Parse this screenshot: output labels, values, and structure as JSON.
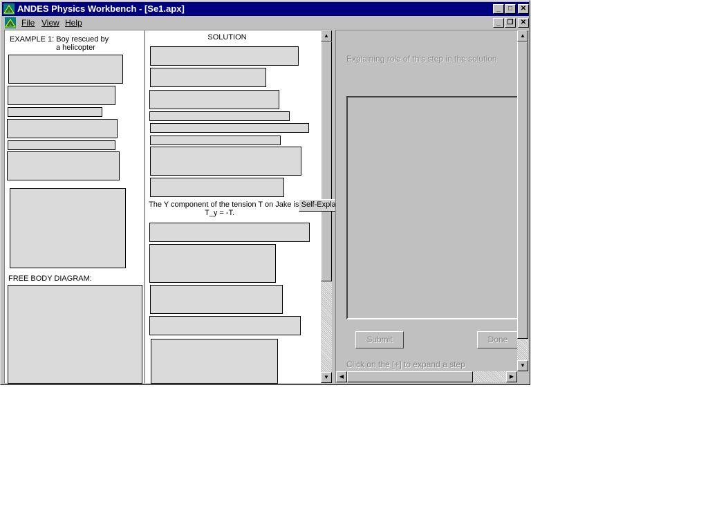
{
  "window": {
    "title": "ANDES Physics Workbench - [Se1.apx]",
    "controls": {
      "minimize": "_",
      "maximize": "□",
      "close": "✕"
    }
  },
  "menubar": {
    "items": [
      {
        "label": "File"
      },
      {
        "label": "View"
      },
      {
        "label": "Help"
      }
    ],
    "controls": {
      "minimize": "_",
      "restore": "❐",
      "close": "✕"
    }
  },
  "example_pane": {
    "title_line1": "EXAMPLE 1: Boy rescued by",
    "title_line2": "a helicopter",
    "fbd_label": "FREE BODY DIAGRAM:"
  },
  "solution_pane": {
    "header": "SOLUTION",
    "step_text_line1": "The Y component of the tension T on Jake is",
    "step_text_line2": "T_y = -T.",
    "self_explain_button": "Self-Explain"
  },
  "explain_pane": {
    "prompt": "Explaining role of this step in the solution",
    "submit_button": "Submit",
    "done_button": "Done",
    "hint": "Click on the [+] to expand a step"
  },
  "colors": {
    "titlebar": "#000080",
    "face": "#c0c0c0"
  }
}
